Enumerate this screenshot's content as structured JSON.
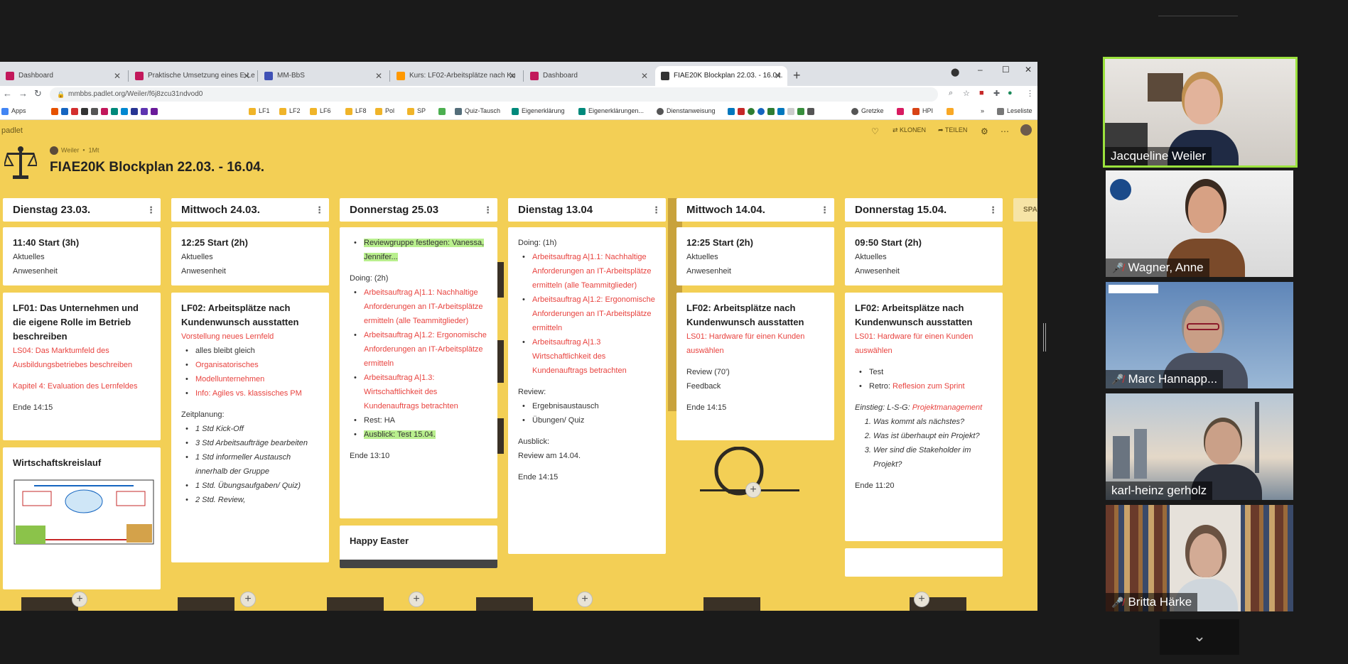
{
  "browser": {
    "tabs": [
      {
        "label": "Dashboard",
        "color": "#c2185b"
      },
      {
        "label": "Praktische Umsetzung eines E-Le",
        "color": "#c2185b"
      },
      {
        "label": "MM-BbS",
        "color": "#3f51b5"
      },
      {
        "label": "Kurs: LF02-Arbeitsplätze nach Ku",
        "color": "#ff9800"
      },
      {
        "label": "Dashboard",
        "color": "#c2185b"
      },
      {
        "label": "FIAE20K Blockplan 22.03. - 16.04.",
        "color": "#333333"
      }
    ],
    "url": "mmbbs.padlet.org/Weiler/f6j8zcu31ndvod0",
    "bookmarks": [
      "Apps",
      "LF1",
      "LF2",
      "LF6",
      "LF8",
      "Pol",
      "SP",
      "Quiz-Tausch",
      "Eigenerklärung",
      "Eigenerklärungen...",
      "Dienstanweisung",
      "Gretzke",
      "HPI",
      "Leseliste"
    ]
  },
  "padlet": {
    "logo": "padlet",
    "tools": {
      "clone": "KLONEN",
      "share": "TEILEN"
    },
    "author": "Weiler",
    "age": "1Mt",
    "title": "FIAE20K Blockplan 22.03. - 16.04.",
    "partial_column": "SPA",
    "columns": [
      {
        "header": "Dienstag 23.03.",
        "card1": {
          "title": "11:40 Start (3h)",
          "lines": [
            "Aktuelles",
            "Anwesenheit"
          ]
        },
        "card2": {
          "title": "LF01: Das Unternehmen und die eigene Rolle im Betrieb beschreiben",
          "red1": "LS04: Das Marktumfeld des Ausbildungsbetriebes beschreiben",
          "red2": "Kapitel 4: Evaluation des Lernfeldes",
          "end": "Ende 14:15"
        },
        "card3": {
          "title": "Wirtschaftskreislauf"
        }
      },
      {
        "header": "Mittwoch 24.03.",
        "card1": {
          "title": "12:25 Start (2h)",
          "lines": [
            "Aktuelles",
            "Anwesenheit"
          ]
        },
        "card2": {
          "title": "LF02: Arbeitsplätze nach Kundenwunsch ausstatten",
          "red1": "Vorstellung neues Lernfeld",
          "bullets": [
            "alles bleibt gleich",
            "Organisatorisches",
            "Modellunternehmen",
            "Info: Agiles vs. klassisches PM"
          ],
          "plan_label": "Zeitplanung:",
          "plan": [
            "1 Std Kick-Off",
            "3 Std Arbeitsaufträge bearbeiten",
            "1 Std informeller Austausch innerhalb der Gruppe",
            "1 Std. Übungsaufgaben/ Quiz)",
            "2 Std. Review,"
          ]
        }
      },
      {
        "header": "Donnerstag 25.03",
        "card1": {
          "highlight": "Reviewgruppe festlegen: Vanessa, Jennifer...",
          "doing": "Doing: (2h)",
          "items": [
            "Arbeitsauftrag A|1.1: Nachhaltige Anforderungen an IT-Arbeitsplätze ermitteln (alle Teammitglieder)",
            "Arbeitsauftrag A|1.2: Ergonomische Anforderungen an IT-Arbeitsplätze ermitteln",
            "Arbeitsauftrag A|1.3: Wirtschaftlichkeit des Kundenauftrags betrachten"
          ],
          "rest": "Rest: HA",
          "outlook": "Ausblick: Test 15.04.",
          "end": "Ende 13:10"
        },
        "card2": {
          "title": "Happy Easter"
        }
      },
      {
        "header": "Dienstag 13.04",
        "card1": {
          "doing": "Doing: (1h)",
          "items": [
            "Arbeitsauftrag A|1.1: Nachhaltige Anforderungen an IT-Arbeitsplätze ermitteln (alle Teammitglieder)",
            "Arbeitsauftrag A|1.2: Ergonomische Anforderungen an IT-Arbeitsplätze ermitteln",
            "Arbeitsauftrag A|1.3 Wirtschaftlichkeit des Kundenauftrags betrachten"
          ],
          "review": "Review:",
          "review_items": [
            "Ergebnisaustausch",
            "Übungen/ Quiz"
          ],
          "outlook": "Ausblick:",
          "outlook_text": "Review am 14.04.",
          "end": "Ende 14:15"
        }
      },
      {
        "header": "Mittwoch 14.04.",
        "card1": {
          "title": "12:25 Start (2h)",
          "lines": [
            "Aktuelles",
            "Anwesenheit"
          ]
        },
        "card2": {
          "title": "LF02: Arbeitsplätze nach Kundenwunsch ausstatten",
          "red1": "LS01: Hardware für einen Kunden auswählen",
          "review": "Review (70')",
          "feedback": "Feedback",
          "end": "Ende 14:15"
        }
      },
      {
        "header": "Donnerstag 15.04.",
        "card1": {
          "title": "09:50 Start (2h)",
          "lines": [
            "Aktuelles",
            "Anwesenheit"
          ]
        },
        "card2": {
          "title": "LF02: Arbeitsplätze nach Kundenwunsch ausstatten",
          "red1": "LS01: Hardware für einen Kunden auswählen",
          "test": "Test",
          "retro_label": "Retro:",
          "retro_red": "Reflesion zum Sprint",
          "einstieg_label": "Einstieg: L-S-G:",
          "einstieg_red": "Projektmanagement",
          "questions": [
            "Was kommt als nächstes?",
            "Was ist überhaupt ein Projekt?",
            "Wer sind die Stakeholder im Projekt?"
          ],
          "end": "Ende 11:20"
        }
      }
    ]
  },
  "participants": [
    {
      "name": "Jacqueline Weiler",
      "muted": false
    },
    {
      "name": "Wagner, Anne",
      "muted": true
    },
    {
      "name": "Marc Hannapp...",
      "muted": true
    },
    {
      "name": "karl-heinz gerholz",
      "muted": false
    },
    {
      "name": "Britta Härke",
      "muted": true
    }
  ]
}
